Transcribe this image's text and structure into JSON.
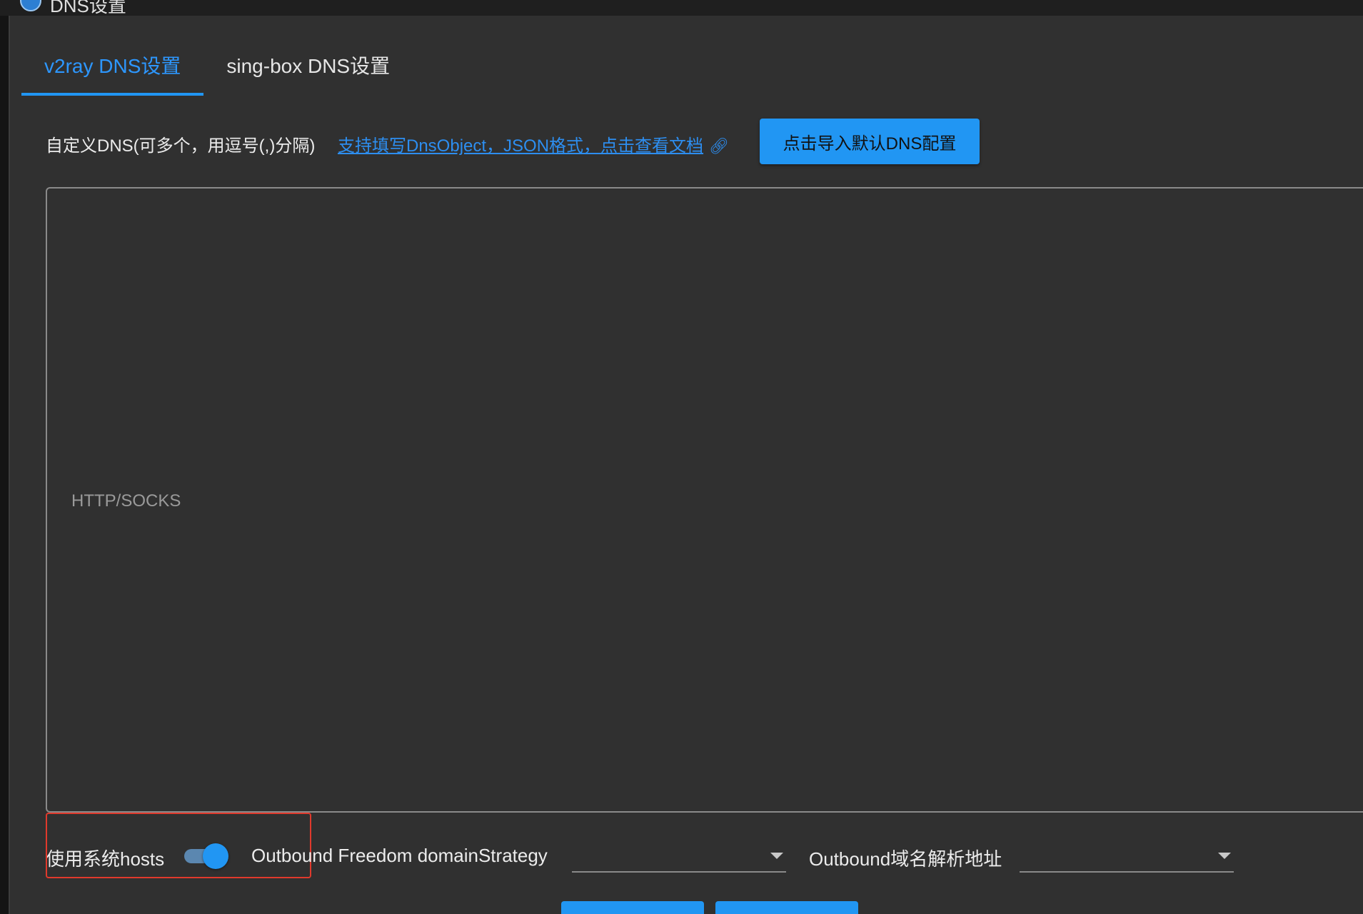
{
  "window": {
    "title": "DNS设置",
    "icon": "app-logo-icon"
  },
  "tabs": [
    {
      "label": "v2ray DNS设置",
      "active": true
    },
    {
      "label": "sing-box DNS设置",
      "active": false
    }
  ],
  "dns_section": {
    "label": "自定义DNS(可多个，用逗号(,)分隔)",
    "doc_link_text": "支持填写DnsObject，JSON格式，点击查看文档",
    "doc_link_icon": "link-icon",
    "import_button_label": "点击导入默认DNS配置"
  },
  "editor": {
    "value": "",
    "placeholder": "HTTP/SOCKS"
  },
  "options": {
    "use_system_hosts_label": "使用系统hosts",
    "use_system_hosts_enabled": true,
    "freedom_strategy_label": "Outbound Freedom domainStrategy",
    "freedom_strategy_value": "",
    "resolve_address_label": "Outbound域名解析地址",
    "resolve_address_value": ""
  },
  "colors": {
    "background": "#303030",
    "accent": "#2196f3",
    "link": "#2d8ef0",
    "highlight": "#e0392c"
  }
}
